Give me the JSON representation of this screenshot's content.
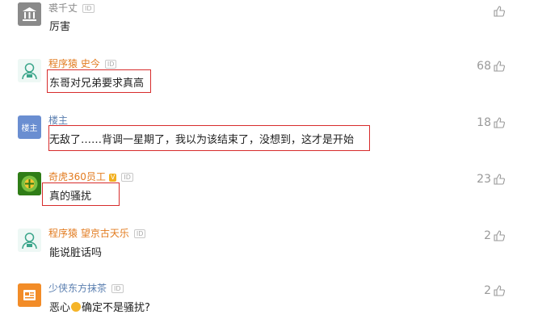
{
  "comments": [
    {
      "user": "裘千丈",
      "text": "厉害",
      "likes": ""
    },
    {
      "user": "程序猿 史今",
      "text": "东哥对兄弟要求真高",
      "likes": "68"
    },
    {
      "user": "楼主",
      "avatar_text": "楼主",
      "text": "无敌了……背调一星期了，我以为该结束了，没想到，这才是开始",
      "likes": "18"
    },
    {
      "user": "奇虎360员工",
      "vip": "V",
      "text": "真的骚扰",
      "likes": "23"
    },
    {
      "user": "程序猿 望京古天乐",
      "text": "能说脏话吗",
      "likes": "2"
    },
    {
      "user": "少侠东方抹茶",
      "text_a": "恶心",
      "text_b": "确定不是骚扰?",
      "likes": "2"
    }
  ],
  "badge": "ID",
  "colors": {
    "highlight_box": "#d72c2c",
    "username_orange": "#e27b1f",
    "username_blue": "#5b7fb0"
  }
}
